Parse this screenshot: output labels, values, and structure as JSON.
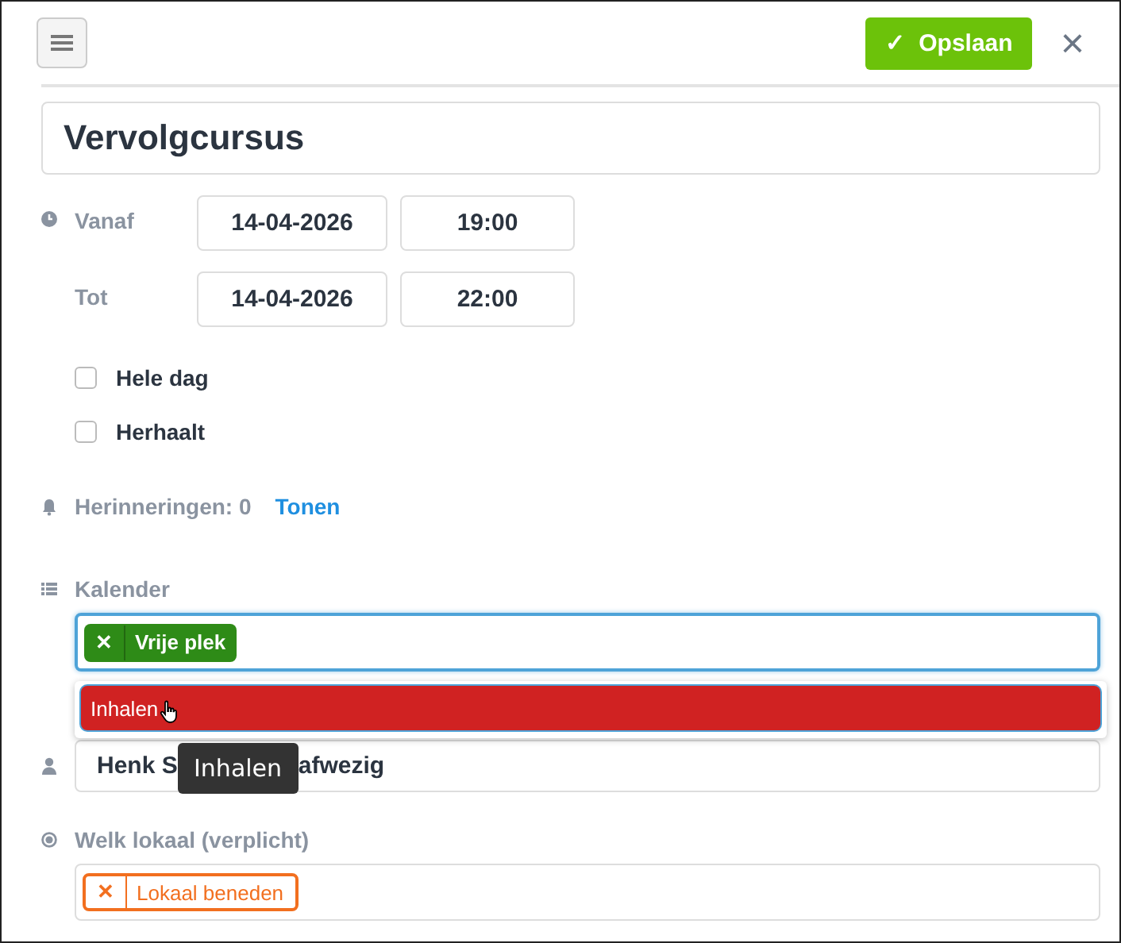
{
  "header": {
    "save_button": "✓",
    "save_label": "Opslaan",
    "close": "×"
  },
  "title_field": {
    "value": "Vervolgcursus"
  },
  "from": {
    "label": "Vanaf",
    "date": "14-04-2026",
    "time": "19:00"
  },
  "to": {
    "label": "Tot",
    "date": "14-04-2026",
    "time": "22:00"
  },
  "checkboxes": [
    {
      "label": "Hele dag",
      "checked": false
    },
    {
      "label": "Herhaalt",
      "checked": false
    }
  ],
  "reminders": {
    "label": "Herinneringen: 0",
    "link": "Tonen"
  },
  "calendar": {
    "label": "Kalender",
    "tags": [
      {
        "remove": "✕",
        "label": "Vrije plek",
        "color": "#2e8b17"
      }
    ],
    "dropdown": [
      {
        "label": "Inhalen",
        "color": "#d02222",
        "selected": true
      }
    ]
  },
  "person_field": {
    "value_start": "Henk S",
    "value_end": "afwezig"
  },
  "tooltip": "Inhalen",
  "room": {
    "label": "Welk lokaal (verplicht)",
    "tags": [
      {
        "remove": "✕",
        "label": "Lokaal beneden",
        "color": "#f26f1f"
      }
    ]
  }
}
